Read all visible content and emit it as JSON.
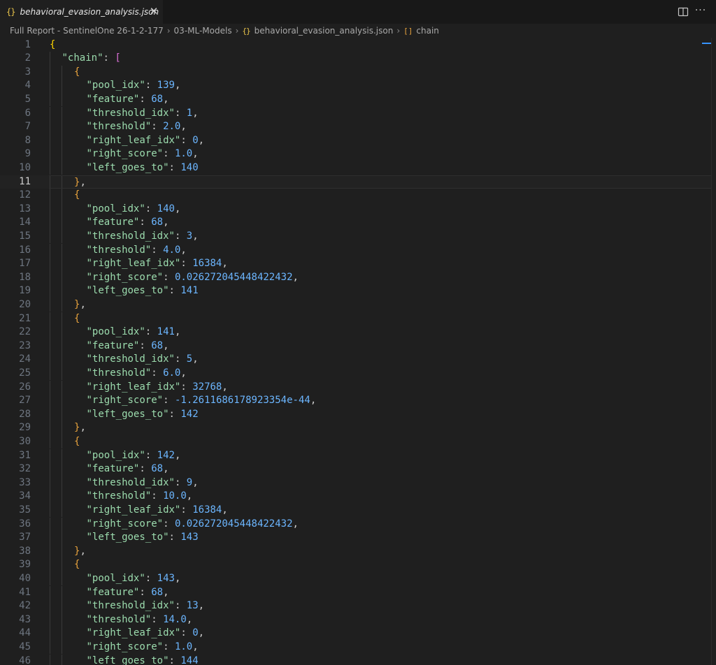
{
  "tab": {
    "icon": "json-braces-icon",
    "icon_glyph": "{}",
    "label": "behavioral_evasion_analysis.json",
    "close_glyph": "✕"
  },
  "actions": {
    "split": "split-editor-icon",
    "more": "···"
  },
  "breadcrumb": {
    "items": [
      "Full Report - SentinelOne 26-1-2-177",
      "03-ML-Models",
      "behavioral_evasion_analysis.json",
      "chain"
    ],
    "json_icon": "{}",
    "array_icon": "[]"
  },
  "editor": {
    "current_line": 11,
    "lines": [
      {
        "n": "1",
        "indent": 0,
        "toks": [
          [
            "b1",
            "{"
          ]
        ]
      },
      {
        "n": "2",
        "indent": 1,
        "toks": [
          [
            "key",
            "\"chain\""
          ],
          [
            "p",
            ": "
          ],
          [
            "b2",
            "["
          ]
        ]
      },
      {
        "n": "3",
        "indent": 2,
        "toks": [
          [
            "b3",
            "{"
          ]
        ]
      },
      {
        "n": "4",
        "indent": 3,
        "toks": [
          [
            "key",
            "\"pool_idx\""
          ],
          [
            "p",
            ": "
          ],
          [
            "num",
            "139"
          ],
          [
            "p",
            ","
          ]
        ]
      },
      {
        "n": "5",
        "indent": 3,
        "toks": [
          [
            "key",
            "\"feature\""
          ],
          [
            "p",
            ": "
          ],
          [
            "num",
            "68"
          ],
          [
            "p",
            ","
          ]
        ]
      },
      {
        "n": "6",
        "indent": 3,
        "toks": [
          [
            "key",
            "\"threshold_idx\""
          ],
          [
            "p",
            ": "
          ],
          [
            "num",
            "1"
          ],
          [
            "p",
            ","
          ]
        ]
      },
      {
        "n": "7",
        "indent": 3,
        "toks": [
          [
            "key",
            "\"threshold\""
          ],
          [
            "p",
            ": "
          ],
          [
            "num",
            "2.0"
          ],
          [
            "p",
            ","
          ]
        ]
      },
      {
        "n": "8",
        "indent": 3,
        "toks": [
          [
            "key",
            "\"right_leaf_idx\""
          ],
          [
            "p",
            ": "
          ],
          [
            "num",
            "0"
          ],
          [
            "p",
            ","
          ]
        ]
      },
      {
        "n": "9",
        "indent": 3,
        "toks": [
          [
            "key",
            "\"right_score\""
          ],
          [
            "p",
            ": "
          ],
          [
            "num",
            "1.0"
          ],
          [
            "p",
            ","
          ]
        ]
      },
      {
        "n": "10",
        "indent": 3,
        "toks": [
          [
            "key",
            "\"left_goes_to\""
          ],
          [
            "p",
            ": "
          ],
          [
            "num",
            "140"
          ]
        ]
      },
      {
        "n": "11",
        "indent": 2,
        "toks": [
          [
            "b3",
            "}"
          ],
          [
            "p",
            ","
          ]
        ]
      },
      {
        "n": "12",
        "indent": 2,
        "toks": [
          [
            "b3",
            "{"
          ]
        ]
      },
      {
        "n": "13",
        "indent": 3,
        "toks": [
          [
            "key",
            "\"pool_idx\""
          ],
          [
            "p",
            ": "
          ],
          [
            "num",
            "140"
          ],
          [
            "p",
            ","
          ]
        ]
      },
      {
        "n": "14",
        "indent": 3,
        "toks": [
          [
            "key",
            "\"feature\""
          ],
          [
            "p",
            ": "
          ],
          [
            "num",
            "68"
          ],
          [
            "p",
            ","
          ]
        ]
      },
      {
        "n": "15",
        "indent": 3,
        "toks": [
          [
            "key",
            "\"threshold_idx\""
          ],
          [
            "p",
            ": "
          ],
          [
            "num",
            "3"
          ],
          [
            "p",
            ","
          ]
        ]
      },
      {
        "n": "16",
        "indent": 3,
        "toks": [
          [
            "key",
            "\"threshold\""
          ],
          [
            "p",
            ": "
          ],
          [
            "num",
            "4.0"
          ],
          [
            "p",
            ","
          ]
        ]
      },
      {
        "n": "17",
        "indent": 3,
        "toks": [
          [
            "key",
            "\"right_leaf_idx\""
          ],
          [
            "p",
            ": "
          ],
          [
            "num",
            "16384"
          ],
          [
            "p",
            ","
          ]
        ]
      },
      {
        "n": "18",
        "indent": 3,
        "toks": [
          [
            "key",
            "\"right_score\""
          ],
          [
            "p",
            ": "
          ],
          [
            "num",
            "0.026272045448422432"
          ],
          [
            "p",
            ","
          ]
        ]
      },
      {
        "n": "19",
        "indent": 3,
        "toks": [
          [
            "key",
            "\"left_goes_to\""
          ],
          [
            "p",
            ": "
          ],
          [
            "num",
            "141"
          ]
        ]
      },
      {
        "n": "20",
        "indent": 2,
        "toks": [
          [
            "b3",
            "}"
          ],
          [
            "p",
            ","
          ]
        ]
      },
      {
        "n": "21",
        "indent": 2,
        "toks": [
          [
            "b3",
            "{"
          ]
        ]
      },
      {
        "n": "22",
        "indent": 3,
        "toks": [
          [
            "key",
            "\"pool_idx\""
          ],
          [
            "p",
            ": "
          ],
          [
            "num",
            "141"
          ],
          [
            "p",
            ","
          ]
        ]
      },
      {
        "n": "23",
        "indent": 3,
        "toks": [
          [
            "key",
            "\"feature\""
          ],
          [
            "p",
            ": "
          ],
          [
            "num",
            "68"
          ],
          [
            "p",
            ","
          ]
        ]
      },
      {
        "n": "24",
        "indent": 3,
        "toks": [
          [
            "key",
            "\"threshold_idx\""
          ],
          [
            "p",
            ": "
          ],
          [
            "num",
            "5"
          ],
          [
            "p",
            ","
          ]
        ]
      },
      {
        "n": "25",
        "indent": 3,
        "toks": [
          [
            "key",
            "\"threshold\""
          ],
          [
            "p",
            ": "
          ],
          [
            "num",
            "6.0"
          ],
          [
            "p",
            ","
          ]
        ]
      },
      {
        "n": "26",
        "indent": 3,
        "toks": [
          [
            "key",
            "\"right_leaf_idx\""
          ],
          [
            "p",
            ": "
          ],
          [
            "num",
            "32768"
          ],
          [
            "p",
            ","
          ]
        ]
      },
      {
        "n": "27",
        "indent": 3,
        "toks": [
          [
            "key",
            "\"right_score\""
          ],
          [
            "p",
            ": "
          ],
          [
            "num",
            "-1.2611686178923354e-44"
          ],
          [
            "p",
            ","
          ]
        ]
      },
      {
        "n": "28",
        "indent": 3,
        "toks": [
          [
            "key",
            "\"left_goes_to\""
          ],
          [
            "p",
            ": "
          ],
          [
            "num",
            "142"
          ]
        ]
      },
      {
        "n": "29",
        "indent": 2,
        "toks": [
          [
            "b3",
            "}"
          ],
          [
            "p",
            ","
          ]
        ]
      },
      {
        "n": "30",
        "indent": 2,
        "toks": [
          [
            "b3",
            "{"
          ]
        ]
      },
      {
        "n": "31",
        "indent": 3,
        "toks": [
          [
            "key",
            "\"pool_idx\""
          ],
          [
            "p",
            ": "
          ],
          [
            "num",
            "142"
          ],
          [
            "p",
            ","
          ]
        ]
      },
      {
        "n": "32",
        "indent": 3,
        "toks": [
          [
            "key",
            "\"feature\""
          ],
          [
            "p",
            ": "
          ],
          [
            "num",
            "68"
          ],
          [
            "p",
            ","
          ]
        ]
      },
      {
        "n": "33",
        "indent": 3,
        "toks": [
          [
            "key",
            "\"threshold_idx\""
          ],
          [
            "p",
            ": "
          ],
          [
            "num",
            "9"
          ],
          [
            "p",
            ","
          ]
        ]
      },
      {
        "n": "34",
        "indent": 3,
        "toks": [
          [
            "key",
            "\"threshold\""
          ],
          [
            "p",
            ": "
          ],
          [
            "num",
            "10.0"
          ],
          [
            "p",
            ","
          ]
        ]
      },
      {
        "n": "35",
        "indent": 3,
        "toks": [
          [
            "key",
            "\"right_leaf_idx\""
          ],
          [
            "p",
            ": "
          ],
          [
            "num",
            "16384"
          ],
          [
            "p",
            ","
          ]
        ]
      },
      {
        "n": "36",
        "indent": 3,
        "toks": [
          [
            "key",
            "\"right_score\""
          ],
          [
            "p",
            ": "
          ],
          [
            "num",
            "0.026272045448422432"
          ],
          [
            "p",
            ","
          ]
        ]
      },
      {
        "n": "37",
        "indent": 3,
        "toks": [
          [
            "key",
            "\"left_goes_to\""
          ],
          [
            "p",
            ": "
          ],
          [
            "num",
            "143"
          ]
        ]
      },
      {
        "n": "38",
        "indent": 2,
        "toks": [
          [
            "b3",
            "}"
          ],
          [
            "p",
            ","
          ]
        ]
      },
      {
        "n": "39",
        "indent": 2,
        "toks": [
          [
            "b3",
            "{"
          ]
        ]
      },
      {
        "n": "40",
        "indent": 3,
        "toks": [
          [
            "key",
            "\"pool_idx\""
          ],
          [
            "p",
            ": "
          ],
          [
            "num",
            "143"
          ],
          [
            "p",
            ","
          ]
        ]
      },
      {
        "n": "41",
        "indent": 3,
        "toks": [
          [
            "key",
            "\"feature\""
          ],
          [
            "p",
            ": "
          ],
          [
            "num",
            "68"
          ],
          [
            "p",
            ","
          ]
        ]
      },
      {
        "n": "42",
        "indent": 3,
        "toks": [
          [
            "key",
            "\"threshold_idx\""
          ],
          [
            "p",
            ": "
          ],
          [
            "num",
            "13"
          ],
          [
            "p",
            ","
          ]
        ]
      },
      {
        "n": "43",
        "indent": 3,
        "toks": [
          [
            "key",
            "\"threshold\""
          ],
          [
            "p",
            ": "
          ],
          [
            "num",
            "14.0"
          ],
          [
            "p",
            ","
          ]
        ]
      },
      {
        "n": "44",
        "indent": 3,
        "toks": [
          [
            "key",
            "\"right_leaf_idx\""
          ],
          [
            "p",
            ": "
          ],
          [
            "num",
            "0"
          ],
          [
            "p",
            ","
          ]
        ]
      },
      {
        "n": "45",
        "indent": 3,
        "toks": [
          [
            "key",
            "\"right_score\""
          ],
          [
            "p",
            ": "
          ],
          [
            "num",
            "1.0"
          ],
          [
            "p",
            ","
          ]
        ]
      },
      {
        "n": "46",
        "indent": 3,
        "toks": [
          [
            "key",
            "\"left_goes_to\""
          ],
          [
            "p",
            ": "
          ],
          [
            "num",
            "144"
          ]
        ]
      }
    ]
  },
  "colors": {
    "background": "#1f1f1f",
    "key": "#9cdcae",
    "number": "#6cb6ff",
    "bracket_level1": "#ffd700",
    "bracket_level2": "#da70d6",
    "bracket_level3": "#e8a33d"
  }
}
